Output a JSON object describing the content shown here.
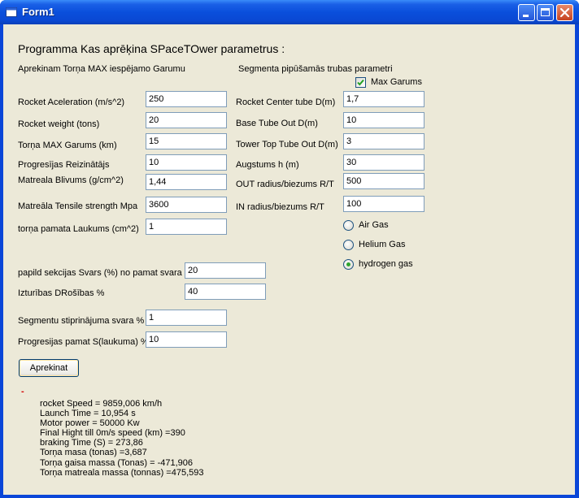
{
  "window": {
    "title": "Form1"
  },
  "heading": "Programma Kas aprēķina SPaceTOwer parametrus :",
  "left_section_title": "Aprekinam Torņa MAX iespējamo Garumu",
  "right_section_title": "Segmenta pipūšamās trubas parametri",
  "max_garums": {
    "label": "Max Garums",
    "checked": true
  },
  "left_fields": [
    {
      "label": "Rocket Aceleration (m/s^2)",
      "value": "250"
    },
    {
      "label": "Rocket weight (tons)",
      "value": "20"
    },
    {
      "label": "Torņa MAX Garums (km)",
      "value": "15"
    },
    {
      "label": "Progresījas Reizinātājs",
      "value": "10"
    },
    {
      "label": "Matreala Blivums (g/cm^2)",
      "value": "1,44"
    },
    {
      "label": "Matreāla Tensile strength Mpa",
      "value": "3600"
    },
    {
      "label": "torņa pamata Laukums (cm^2)",
      "value": "1"
    }
  ],
  "mid_fields": [
    {
      "label": "papild sekcijas Svars (%) no pamat svara",
      "value": "20"
    },
    {
      "label": "Izturības DRošības %",
      "value": "40"
    }
  ],
  "lower_fields": [
    {
      "label": "Segmentu stiprinājuma svara %",
      "value": "1"
    },
    {
      "label": "Progresijas pamat S(laukuma) %",
      "value": "10"
    }
  ],
  "right_fields": [
    {
      "label": "Rocket Center tube  D(m)",
      "value": "1,7"
    },
    {
      "label": "Base Tube Out D(m)",
      "value": "10"
    },
    {
      "label": "Tower Top Tube Out D(m)",
      "value": "3"
    },
    {
      "label": "Augstums h  (m)",
      "value": "30"
    },
    {
      "label": "OUT radius/biezums R/T",
      "value": "500"
    },
    {
      "label": "IN radius/biezums R/T",
      "value": "100"
    }
  ],
  "gas_options": [
    {
      "label": "Air Gas",
      "selected": false
    },
    {
      "label": "Helium Gas",
      "selected": false
    },
    {
      "label": "hydrogen gas",
      "selected": true
    }
  ],
  "calc_button": "Aprekinat",
  "status_mark": "-",
  "results": [
    "rocket Speed = 9859,006 km/h",
    "Launch Time = 10,954 s",
    "Motor power = 50000 Kw",
    "Final Hight till 0m/s speed (km) =390",
    "braking Time (S) = 273,86",
    "Torņa masa (tonas) =3,687",
    "Torņa gaisa massa (Tonas) = -471,906",
    "Torņa matreala massa (tonnas) =475,593"
  ]
}
